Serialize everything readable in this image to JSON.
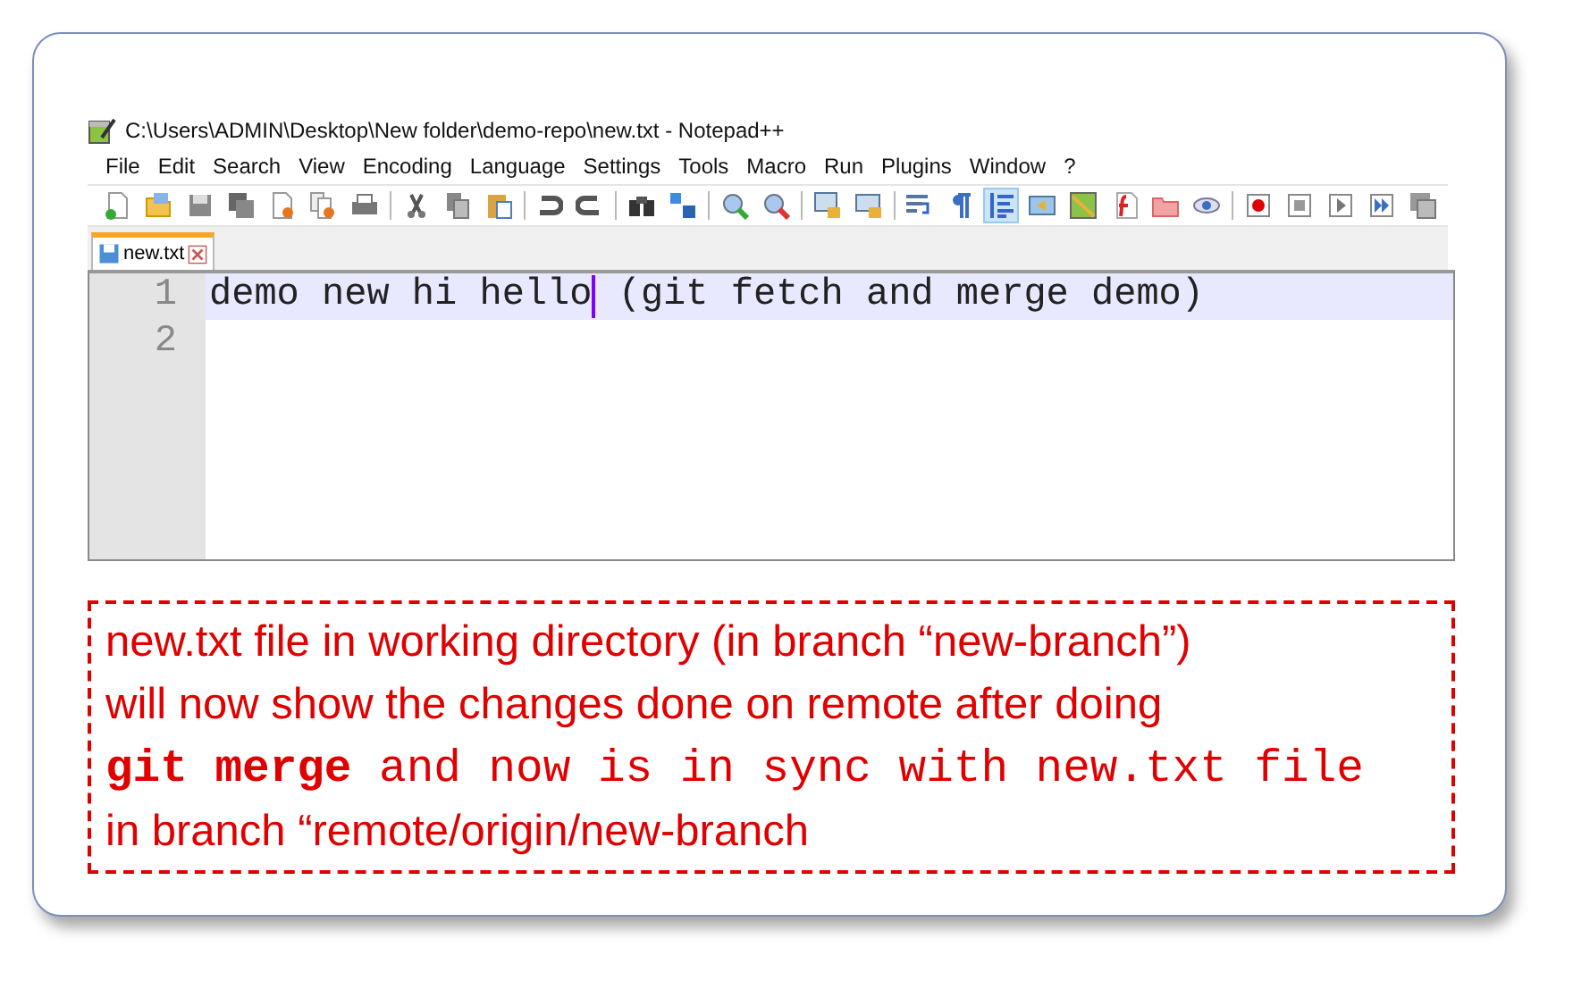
{
  "window": {
    "title": "C:\\Users\\ADMIN\\Desktop\\New folder\\demo-repo\\new.txt - Notepad++"
  },
  "menu": [
    "File",
    "Edit",
    "Search",
    "View",
    "Encoding",
    "Language",
    "Settings",
    "Tools",
    "Macro",
    "Run",
    "Plugins",
    "Window",
    "?"
  ],
  "toolbar": [
    [
      {
        "pressed": false
      },
      {
        "pressed": false
      },
      {
        "pressed": false
      },
      {
        "pressed": false
      },
      {
        "pressed": false
      },
      {
        "pressed": false
      },
      {
        "pressed": false
      }
    ],
    [
      {
        "pressed": false
      },
      {
        "pressed": false
      },
      {
        "pressed": false
      }
    ],
    [
      {
        "pressed": false
      },
      {
        "pressed": false
      }
    ],
    [
      {
        "pressed": false
      },
      {
        "pressed": false
      }
    ],
    [
      {
        "pressed": false
      },
      {
        "pressed": false
      }
    ],
    [
      {
        "pressed": false
      },
      {
        "pressed": false
      }
    ],
    [
      {
        "pressed": false
      },
      {
        "pressed": false
      },
      {
        "pressed": true
      },
      {
        "pressed": false
      },
      {
        "pressed": false
      },
      {
        "pressed": false
      },
      {
        "pressed": false
      },
      {
        "pressed": false
      }
    ],
    [
      {
        "pressed": false
      },
      {
        "pressed": false
      },
      {
        "pressed": false
      },
      {
        "pressed": false
      },
      {
        "pressed": false
      }
    ]
  ],
  "tabs": [
    {
      "label": "new.txt",
      "selected": true
    }
  ],
  "editor": {
    "lines": [
      {
        "number": "1",
        "text_before_caret": "demo new hi hello",
        "text_after_caret": " (git fetch and merge demo)",
        "current": true
      },
      {
        "number": "2",
        "current": false
      }
    ]
  },
  "callout": {
    "lines": [
      [
        {
          "kind": "sans",
          "text": "new.txt file in working directory (in branch “new-branch”)"
        }
      ],
      [
        {
          "kind": "sans",
          "text": "will now show the changes done on remote after doing"
        }
      ],
      [
        {
          "kind": "code_bold",
          "text": "git merge"
        },
        {
          "kind": "code",
          "text": " and now is in sync with new.txt file"
        }
      ],
      [
        {
          "kind": "sans",
          "text": "in branch “remote/origin/new-branch"
        }
      ]
    ]
  }
}
